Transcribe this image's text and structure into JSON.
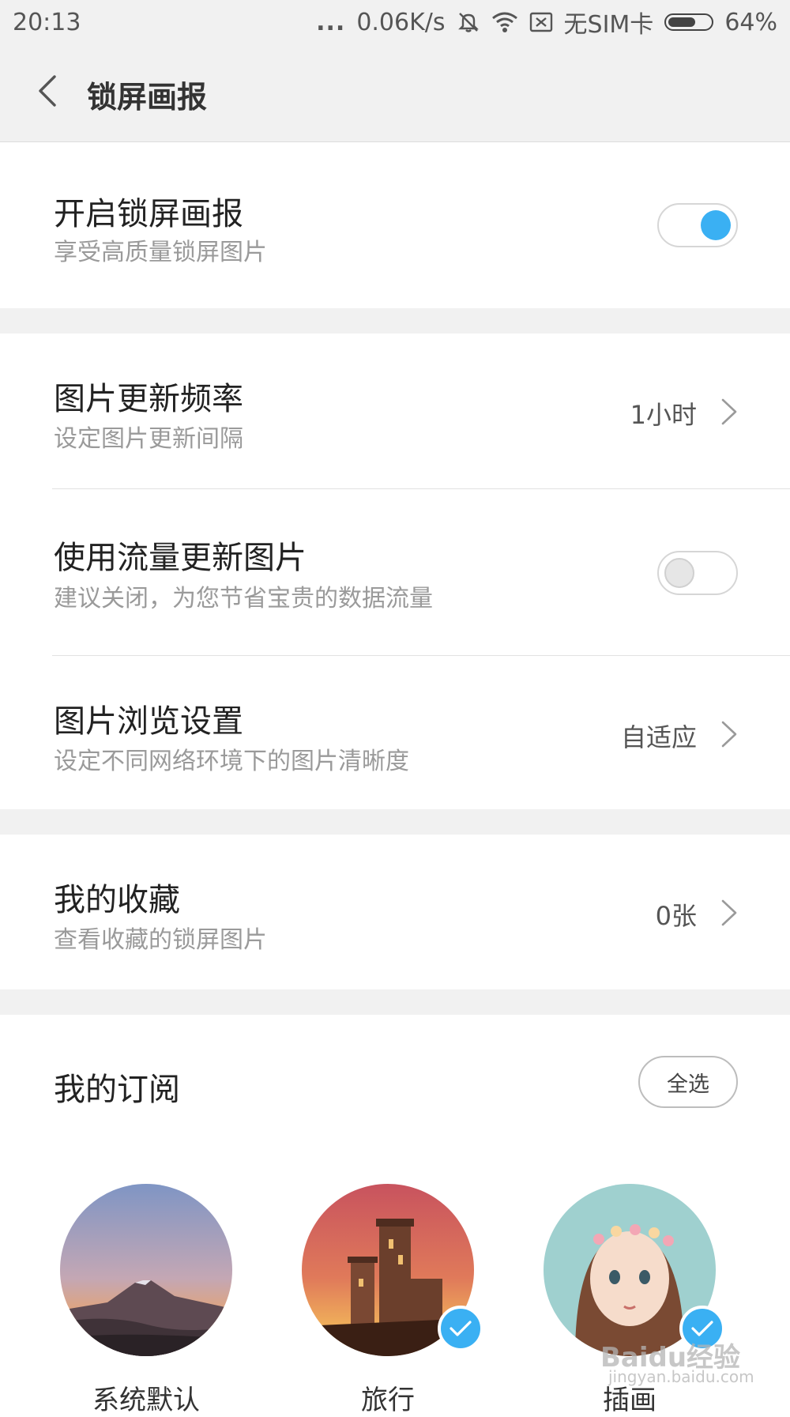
{
  "status_bar": {
    "time": "20:13",
    "dots": "...",
    "speed": "0.06K/s",
    "sim": "无SIM卡",
    "battery": "64%",
    "battery_level": 0.64,
    "icons": [
      "mute-icon",
      "wifi-icon",
      "no-sim-icon",
      "battery-icon"
    ]
  },
  "header": {
    "title": "锁屏画报"
  },
  "lockscreen": {
    "title": "开启锁屏画报",
    "subtitle": "享受高质量锁屏图片",
    "enabled": true
  },
  "settings": {
    "update_frequency": {
      "title": "图片更新频率",
      "subtitle": "设定图片更新间隔",
      "value": "1小时"
    },
    "mobile_data": {
      "title": "使用流量更新图片",
      "subtitle": "建议关闭，为您节省宝贵的数据流量",
      "enabled": false
    },
    "browse": {
      "title": "图片浏览设置",
      "subtitle": "设定不同网络环境下的图片清晰度",
      "value": "自适应"
    }
  },
  "favorites": {
    "title": "我的收藏",
    "subtitle": "查看收藏的锁屏图片",
    "value": "0张"
  },
  "subscriptions": {
    "title": "我的订阅",
    "select_all": "全选",
    "items": [
      {
        "label": "系统默认",
        "checked": false
      },
      {
        "label": "旅行",
        "checked": true
      },
      {
        "label": "插画",
        "checked": true
      }
    ]
  },
  "watermark": {
    "logo": "Baidu经验",
    "url": "jingyan.baidu.com"
  },
  "colors": {
    "accent": "#3ab0f3",
    "background": "#f1f1f1"
  }
}
